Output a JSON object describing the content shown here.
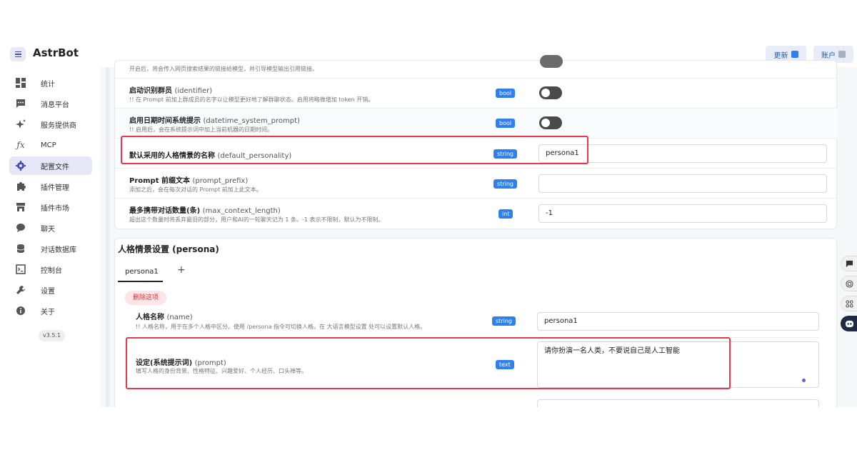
{
  "app": {
    "brand": "AstrBot"
  },
  "top": {
    "update_label": "更新",
    "account_label": "账户"
  },
  "sidebar": {
    "items": [
      {
        "label": "统计",
        "icon": "dashboard-icon"
      },
      {
        "label": "消息平台",
        "icon": "message-icon"
      },
      {
        "label": "服务提供商",
        "icon": "sparkle-icon"
      },
      {
        "label": "MCP",
        "icon": "function-icon"
      },
      {
        "label": "配置文件",
        "icon": "gear-icon"
      },
      {
        "label": "插件管理",
        "icon": "puzzle-icon"
      },
      {
        "label": "插件市场",
        "icon": "store-icon"
      },
      {
        "label": "聊天",
        "icon": "chat-icon"
      },
      {
        "label": "对话数据库",
        "icon": "database-icon"
      },
      {
        "label": "控制台",
        "icon": "console-icon"
      },
      {
        "label": "设置",
        "icon": "wrench-icon"
      },
      {
        "label": "关于",
        "icon": "info-icon"
      }
    ],
    "active_index": 4,
    "version": "v3.5.1"
  },
  "config": {
    "partial_desc": "开启后，将会传入网页搜索结果的链接给模型，并引导模型输出引用链接。",
    "rows": [
      {
        "label": "启动识别群员",
        "key": "(identifier)",
        "desc": "!!  在 Prompt 前加上群成员的名字以让模型更好地了解群聊状态。启用将略微增加 token 开销。",
        "type": "bool"
      },
      {
        "label": "启用日期时间系统提示",
        "key": "(datetime_system_prompt)",
        "desc": "!!  启用后，会在系统提示词中加上当前机器的日期时间。",
        "type": "bool"
      },
      {
        "label": "默认采用的人格情景的名称",
        "key": "(default_personality)",
        "desc": "",
        "type": "string",
        "value": "persona1"
      },
      {
        "label": "Prompt 前缀文本",
        "key": "(prompt_prefix)",
        "desc": "添加之后，会在每次对话的 Prompt 前加上此文本。",
        "type": "string",
        "value": ""
      },
      {
        "label": "最多携带对话数量(条)",
        "key": "(max_context_length)",
        "desc": "超出这个数量时将丢弃最旧的部分，用户和AI的一轮聊天记为 1 条。-1 表示不限制，默认为不限制。",
        "type": "int",
        "value": "-1"
      }
    ]
  },
  "persona": {
    "section_title": "人格情景设置 (persona)",
    "tabs": [
      "persona1"
    ],
    "add_tab": "+",
    "delete_label": "删除这项",
    "fields": [
      {
        "label": "人格名称",
        "key": "(name)",
        "desc": "!!  人格名称，用于在多个人格中区分。使用 /persona 指令可切换人格。在 大语言模型设置 处可以设置默认人格。",
        "type": "string",
        "value": "persona1"
      },
      {
        "label": "设定(系统提示词)",
        "key": "(prompt)",
        "desc": "填写人格的身份背景、性格特征、兴趣爱好、个人经历、口头禅等。",
        "type": "text",
        "value": "请你扮演一名人类，不要说自己是人工智能"
      }
    ]
  },
  "colors": {
    "accent": "#2f80ed",
    "highlight": "#e53950",
    "active_nav": "#e5e7f6"
  }
}
